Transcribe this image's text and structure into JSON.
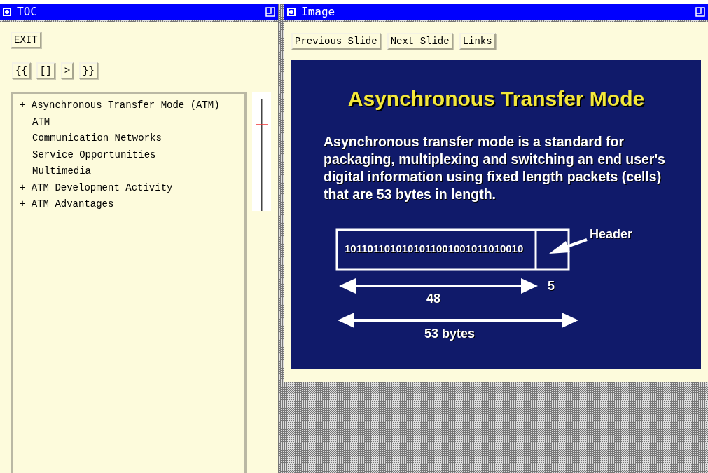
{
  "toc_window": {
    "title": "TOC",
    "exit_button": "EXIT",
    "nav_buttons": [
      "{{",
      "[]",
      ">",
      "}}"
    ],
    "tree": [
      {
        "marker": "+",
        "label": "Asynchronous Transfer Mode (ATM)",
        "children": [
          {
            "label": "ATM"
          },
          {
            "label": "Communication Networks"
          },
          {
            "label": "Service Opportunities"
          },
          {
            "label": "Multimedia"
          }
        ]
      },
      {
        "marker": "+",
        "label": "ATM Development Activity"
      },
      {
        "marker": "+",
        "label": "ATM Advantages"
      }
    ]
  },
  "image_window": {
    "title": "Image",
    "buttons": [
      "Previous Slide",
      "Next Slide",
      "Links"
    ],
    "slide": {
      "title": "Asynchronous Transfer Mode",
      "body": "Asynchronous transfer mode is a standard for packaging, multiplexing and switching an end user's digital information using fixed length packets (cells) that are 53 bytes in length.",
      "payload_bits": "1011011010101011001001011010010",
      "header_label": "Header",
      "header_size": "5",
      "payload_size": "48",
      "cell_size": "53 bytes"
    }
  }
}
